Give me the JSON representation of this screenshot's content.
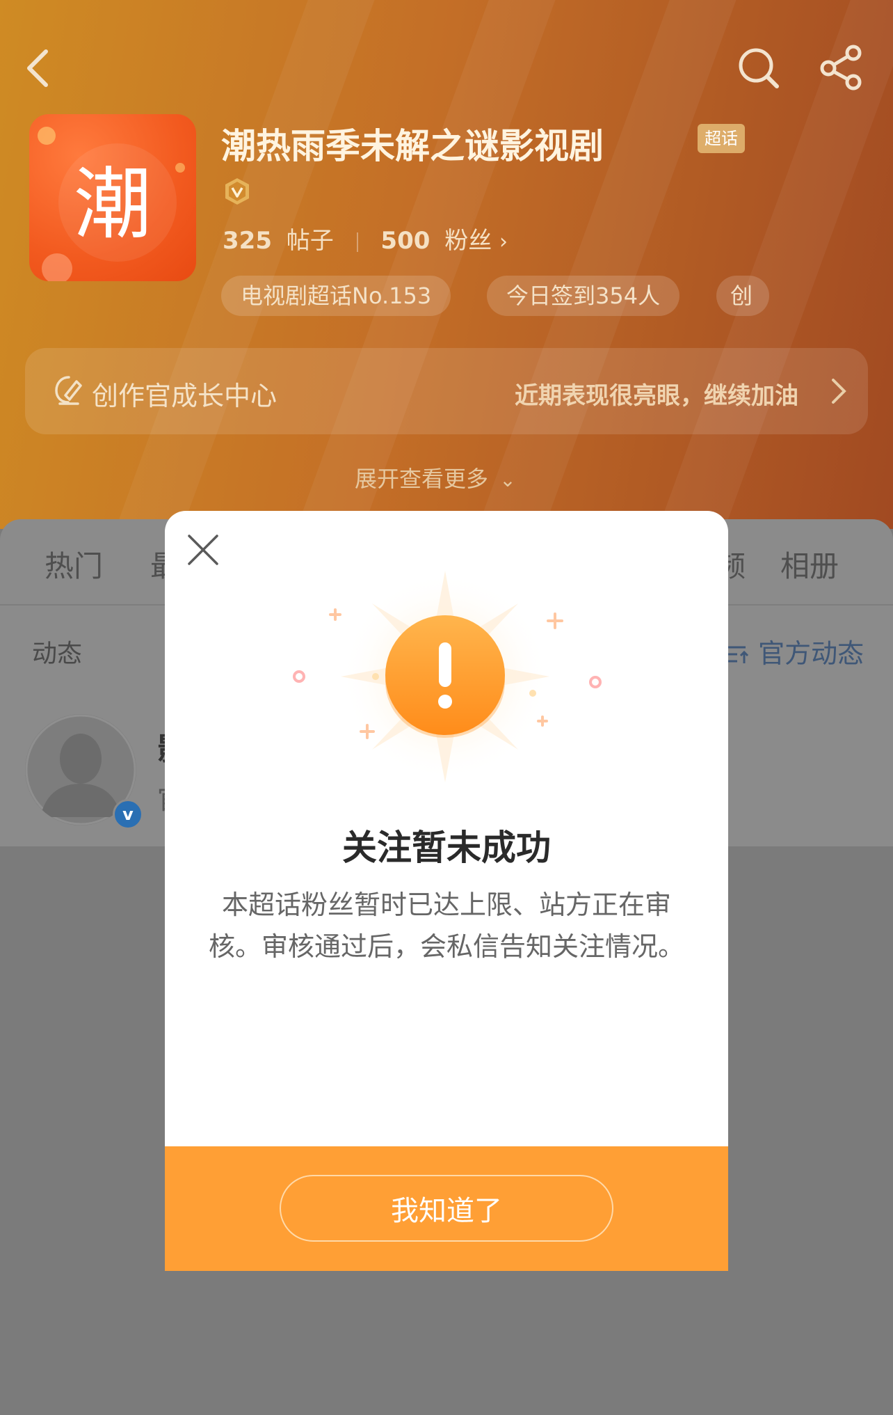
{
  "header": {
    "back_icon": "chevron-left-icon",
    "search_icon": "search-icon",
    "share_icon": "share-icon",
    "logo_char": "潮",
    "title": "潮热雨季未解之谜影视剧",
    "badge": "超话",
    "stats": {
      "posts_count": "325",
      "posts_label": "帖子",
      "fans_count": "500",
      "fans_label": "粉丝"
    },
    "chips": [
      "电视剧超话No.153",
      "今日签到354人",
      "创"
    ],
    "growth": {
      "label": "创作官成长中心",
      "note": "近期表现很亮眼，继续加油"
    },
    "expand_more": "展开查看更多"
  },
  "tabs": [
    "热门",
    "最",
    "频",
    "相册"
  ],
  "feed": {
    "section_label": "动态",
    "official_link": "官方动态",
    "avatar_badge": "v",
    "first_item_name_partial": "影",
    "first_item_sub_partial": "官"
  },
  "modal": {
    "title": "关注暂未成功",
    "message": "本超话粉丝暂时已达上限、站方正在审核。审核通过后，会私信告知关注情况。",
    "button_label": "我知道了",
    "close_icon": "close-icon",
    "illustration_icon": "exclamation-icon"
  },
  "colors": {
    "header_gradient_start": "#cf8b24",
    "header_gradient_end": "#a14a22",
    "modal_accent": "#ff9f35",
    "logo": "#f25a1f"
  }
}
